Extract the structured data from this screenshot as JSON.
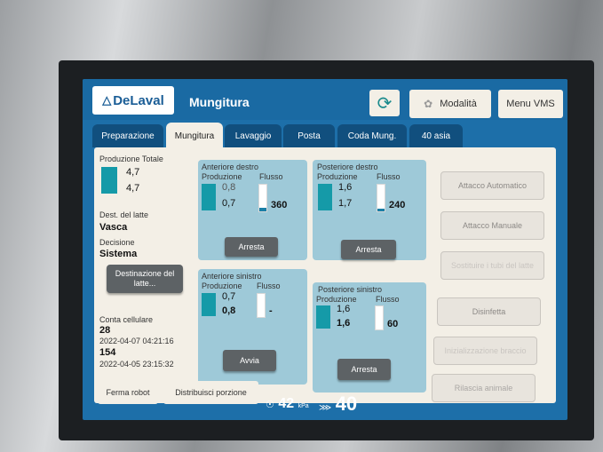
{
  "header": {
    "logo_text": "DeLaval",
    "title": "Mungitura",
    "modalita_label": "Modalità",
    "menu_label": "Menu VMS"
  },
  "tabs": [
    {
      "label": "Preparazione"
    },
    {
      "label": "Mungitura",
      "active": true
    },
    {
      "label": "Lavaggio"
    },
    {
      "label": "Posta"
    },
    {
      "label": "Coda Mung."
    },
    {
      "label": "40 asia"
    }
  ],
  "left": {
    "produzione_totale_label": "Produzione Totale",
    "prod_val1": "4,7",
    "prod_val2": "4,7",
    "dest_label": "Dest. del latte",
    "dest_value": "Vasca",
    "decisione_label": "Decisione",
    "decisione_value": "Sistema",
    "dest_button": "Destinazione del latte...",
    "conta_label": "Conta cellulare",
    "conta1_value": "28",
    "conta1_date": "2022-04-07 04:21:16",
    "conta2_value": "154",
    "conta2_date": "2022-04-05 23:15:32"
  },
  "quarters": {
    "ad": {
      "title": "Anteriore destro",
      "prod_label": "Produzione",
      "flow_label": "Flusso",
      "prod1": "0,8",
      "prod2": "0,7",
      "flow": "360",
      "flow_level": 0.15,
      "button": "Arresta"
    },
    "pd": {
      "title": "Posteriore destro",
      "prod_label": "Produzione",
      "flow_label": "Flusso",
      "prod1": "1,6",
      "prod2": "1,7",
      "flow": "240",
      "flow_level": 0.1,
      "button": "Arresta"
    },
    "as": {
      "title": "Anteriore sinistro",
      "prod_label": "Produzione",
      "flow_label": "Flusso",
      "prod1": "0,7",
      "prod2": "0,8",
      "flow": "-",
      "flow_level": 0,
      "button": "Avvia"
    },
    "ps": {
      "title": "Posteriore sinistro",
      "prod_label": "Produzione",
      "flow_label": "Flusso",
      "prod1": "1,6",
      "prod2": "1,6",
      "flow": "60",
      "flow_level": 0,
      "button": "Arresta"
    }
  },
  "right_buttons": [
    {
      "label": "Attacco Automatico",
      "enabled": true
    },
    {
      "label": "Attacco Manuale",
      "enabled": true
    },
    {
      "label": "Sostituire i tubi del latte",
      "enabled": false
    },
    {
      "label": "Disinfetta",
      "enabled": true
    },
    {
      "label": "Inizializzazione braccio",
      "enabled": false
    },
    {
      "label": "Rilascia animale",
      "enabled": true
    }
  ],
  "bottom": {
    "ferma_label": "Ferma robot",
    "distribuisci_label": "Distribuisci porzione",
    "pressure_value": "42",
    "pressure_unit": "kPa",
    "pulsation_value": "40"
  },
  "colors": {
    "screen_bg": "#1d6fa9",
    "panel_bg": "#f3efe6",
    "quarter_bg": "#9ec9d8",
    "teal": "#159aa8",
    "button_dark": "#5d6265"
  }
}
